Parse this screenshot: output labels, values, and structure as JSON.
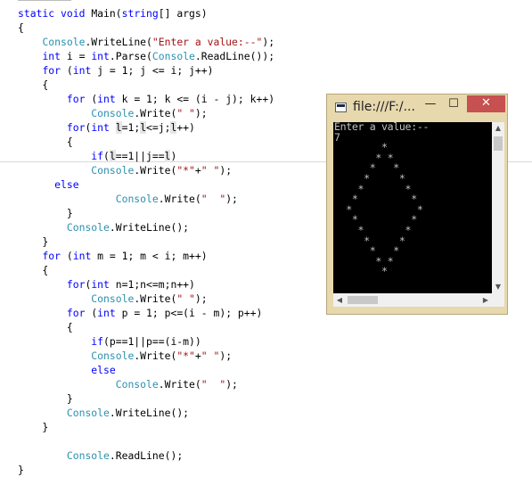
{
  "code": {
    "lines": [
      [
        {
          "t": "static ",
          "c": "kw"
        },
        {
          "t": "void ",
          "c": "kw"
        },
        {
          "t": "Main("
        },
        {
          "t": "string",
          "c": "kw"
        },
        {
          "t": "[] args)"
        }
      ],
      [
        {
          "t": "{"
        }
      ],
      [
        {
          "t": "    "
        },
        {
          "t": "Console",
          "c": "ty"
        },
        {
          "t": ".WriteLine("
        },
        {
          "t": "\"Enter a value:--\"",
          "c": "str"
        },
        {
          "t": ");"
        }
      ],
      [
        {
          "t": "    "
        },
        {
          "t": "int ",
          "c": "kw"
        },
        {
          "t": "i = "
        },
        {
          "t": "int",
          "c": "kw"
        },
        {
          "t": ".Parse("
        },
        {
          "t": "Console",
          "c": "ty"
        },
        {
          "t": ".ReadLine());"
        }
      ],
      [
        {
          "t": "    "
        },
        {
          "t": "for ",
          "c": "kw"
        },
        {
          "t": "("
        },
        {
          "t": "int ",
          "c": "kw"
        },
        {
          "t": "j = 1; j <= i; j++)"
        }
      ],
      [
        {
          "t": "    {"
        }
      ],
      [
        {
          "t": "        "
        },
        {
          "t": "for ",
          "c": "kw"
        },
        {
          "t": "("
        },
        {
          "t": "int ",
          "c": "kw"
        },
        {
          "t": "k = 1; k <= (i - j); k++)"
        }
      ],
      [
        {
          "t": "            "
        },
        {
          "t": "Console",
          "c": "ty"
        },
        {
          "t": ".Write("
        },
        {
          "t": "\" \"",
          "c": "str"
        },
        {
          "t": ");"
        }
      ],
      [
        {
          "t": "        "
        },
        {
          "t": "for",
          "c": "kw"
        },
        {
          "t": "("
        },
        {
          "t": "int ",
          "c": "kw"
        },
        {
          "t": "l",
          "c": "hl"
        },
        {
          "t": "=1;"
        },
        {
          "t": "l",
          "c": "hl"
        },
        {
          "t": "<=j;"
        },
        {
          "t": "l",
          "c": "hl"
        },
        {
          "t": "++)"
        }
      ],
      [
        {
          "t": "        {"
        }
      ],
      [
        {
          "t": "            "
        },
        {
          "t": "if",
          "c": "kw"
        },
        {
          "t": "("
        },
        {
          "t": "l",
          "c": "hl"
        },
        {
          "t": "==1||j=="
        },
        {
          "t": "l",
          "c": "hl"
        },
        {
          "t": ")"
        }
      ],
      [
        {
          "t": "            "
        },
        {
          "t": "Console",
          "c": "ty"
        },
        {
          "t": ".Write("
        },
        {
          "t": "\"*\"",
          "c": "str"
        },
        {
          "t": "+"
        },
        {
          "t": "\" \"",
          "c": "str"
        },
        {
          "t": ");"
        }
      ],
      [
        {
          "t": "      "
        },
        {
          "t": "else",
          "c": "kw"
        }
      ],
      [
        {
          "t": "                "
        },
        {
          "t": "Console",
          "c": "ty"
        },
        {
          "t": ".Write("
        },
        {
          "t": "\"  \"",
          "c": "str"
        },
        {
          "t": ");"
        }
      ],
      [
        {
          "t": "        }"
        }
      ],
      [
        {
          "t": "        "
        },
        {
          "t": "Console",
          "c": "ty"
        },
        {
          "t": ".WriteLine();"
        }
      ],
      [
        {
          "t": "    }"
        }
      ],
      [
        {
          "t": "    "
        },
        {
          "t": "for ",
          "c": "kw"
        },
        {
          "t": "("
        },
        {
          "t": "int ",
          "c": "kw"
        },
        {
          "t": "m = 1; m < i; m++)"
        }
      ],
      [
        {
          "t": "    {"
        }
      ],
      [
        {
          "t": "        "
        },
        {
          "t": "for",
          "c": "kw"
        },
        {
          "t": "("
        },
        {
          "t": "int ",
          "c": "kw"
        },
        {
          "t": "n=1;n<=m;n++)"
        }
      ],
      [
        {
          "t": "            "
        },
        {
          "t": "Console",
          "c": "ty"
        },
        {
          "t": ".Write("
        },
        {
          "t": "\" \"",
          "c": "str"
        },
        {
          "t": ");"
        }
      ],
      [
        {
          "t": "        "
        },
        {
          "t": "for ",
          "c": "kw"
        },
        {
          "t": "("
        },
        {
          "t": "int ",
          "c": "kw"
        },
        {
          "t": "p = 1; p<=(i - m); p++)"
        }
      ],
      [
        {
          "t": "        {"
        }
      ],
      [
        {
          "t": "            "
        },
        {
          "t": "if",
          "c": "kw"
        },
        {
          "t": "(p==1||p==(i-m))"
        }
      ],
      [
        {
          "t": "            "
        },
        {
          "t": "Console",
          "c": "ty"
        },
        {
          "t": ".Write("
        },
        {
          "t": "\"*\"",
          "c": "str"
        },
        {
          "t": "+"
        },
        {
          "t": "\" \"",
          "c": "str"
        },
        {
          "t": ");"
        }
      ],
      [
        {
          "t": "            "
        },
        {
          "t": "else",
          "c": "kw"
        }
      ],
      [
        {
          "t": "                "
        },
        {
          "t": "Console",
          "c": "ty"
        },
        {
          "t": ".Write("
        },
        {
          "t": "\"  \"",
          "c": "str"
        },
        {
          "t": ");"
        }
      ],
      [
        {
          "t": "        }"
        }
      ],
      [
        {
          "t": "        "
        },
        {
          "t": "Console",
          "c": "ty"
        },
        {
          "t": ".WriteLine();"
        }
      ],
      [
        {
          "t": "    }"
        }
      ],
      [
        {
          "t": ""
        }
      ],
      [
        {
          "t": "        "
        },
        {
          "t": "Console",
          "c": "ty"
        },
        {
          "t": ".ReadLine();"
        }
      ],
      [
        {
          "t": "}"
        }
      ]
    ]
  },
  "console_window": {
    "title": "file:///F:/...",
    "min_label": "—",
    "max_label": "☐",
    "close_label": "✕",
    "output": "Enter a value:--\n7\n        *\n       * *\n      *   *\n     *     *\n    *       *\n   *         *\n  *           *\n   *         *\n    *       *\n     *     *\n      *   *\n       * *\n        *",
    "scroll_up": "▲",
    "scroll_down": "▼",
    "scroll_left": "◀",
    "scroll_right": "▶"
  }
}
